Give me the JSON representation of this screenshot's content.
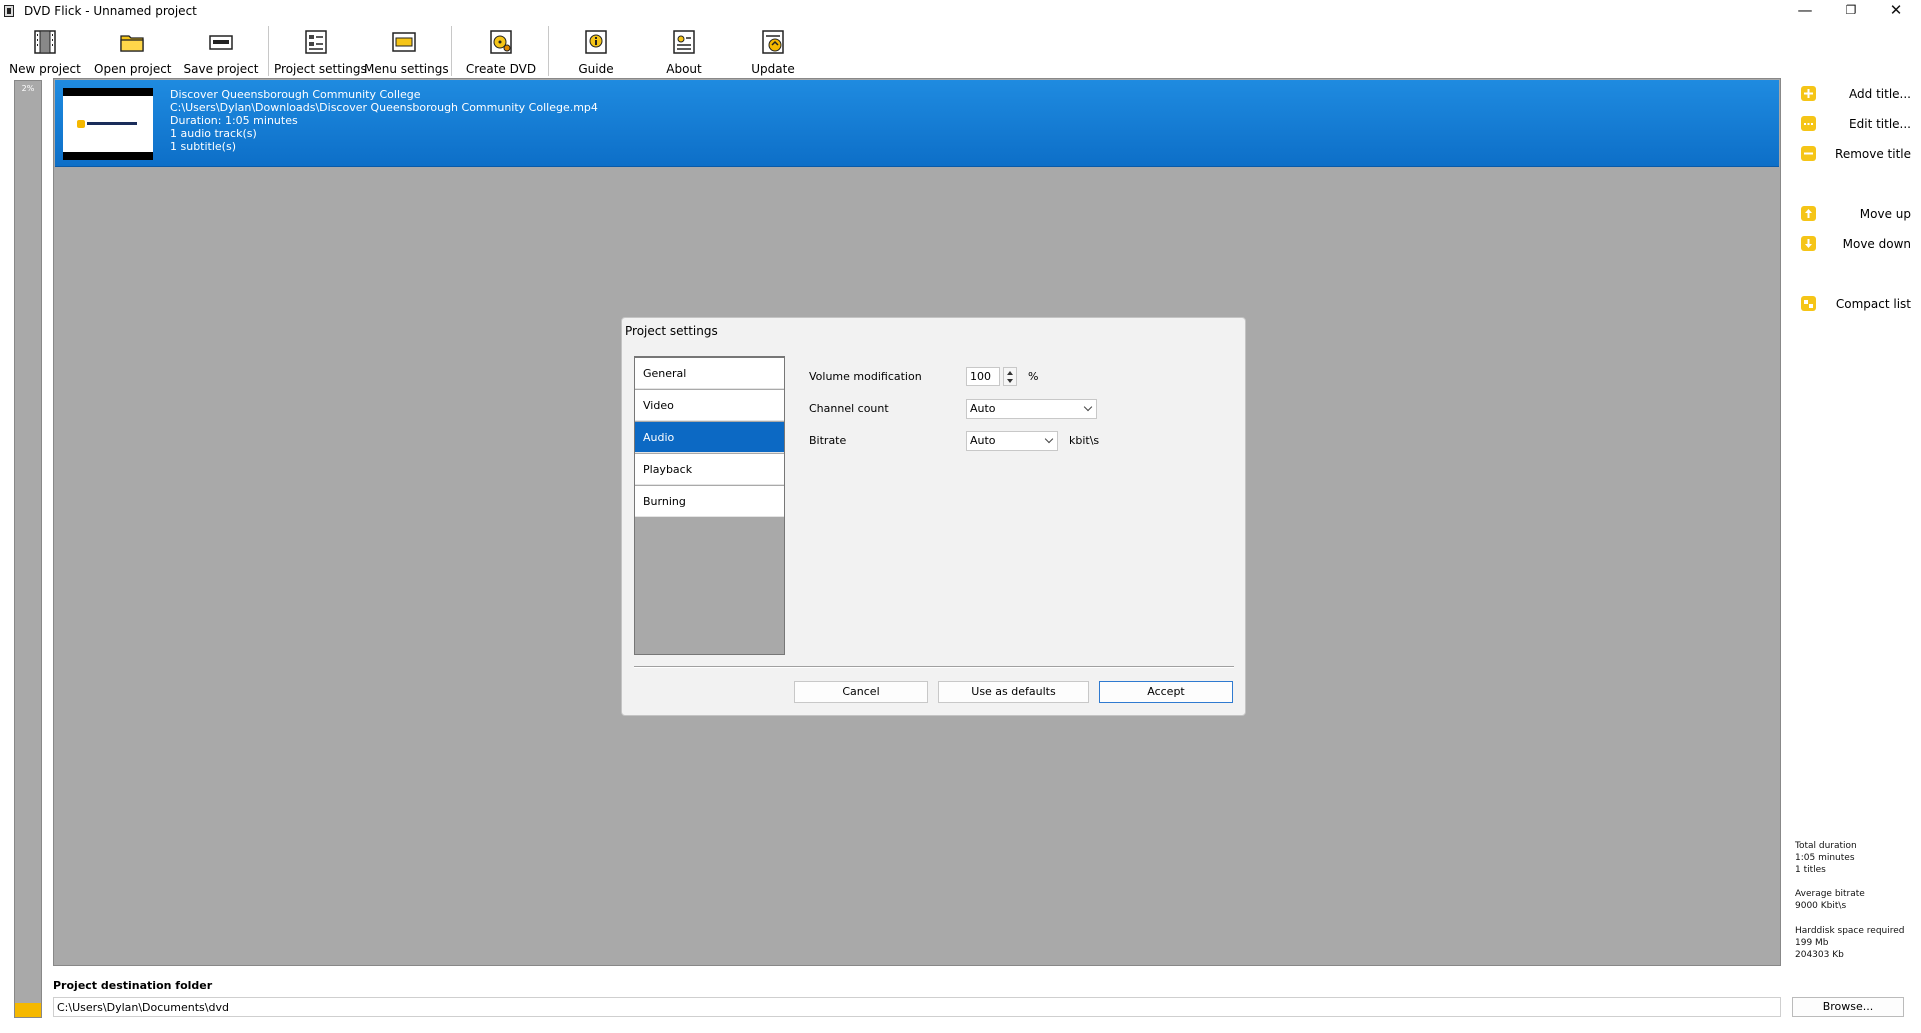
{
  "window": {
    "title": "DVD Flick - Unnamed project",
    "minimize": "—",
    "maximize": "❐",
    "close": "✕"
  },
  "toolbar": {
    "new_project": "New project",
    "open_project": "Open project",
    "save_project": "Save project",
    "project_settings": "Project settings",
    "menu_settings": "Menu settings",
    "create_dvd": "Create DVD",
    "guide": "Guide",
    "about": "About",
    "update": "Update"
  },
  "progress": {
    "label": "2%",
    "value_percent": 2
  },
  "titles": [
    {
      "name": "Discover Queensborough Community College",
      "path": "C:\\Users\\Dylan\\Downloads\\Discover Queensborough Community College.mp4",
      "duration": "Duration: 1:05 minutes",
      "audio": "1 audio track(s)",
      "subtitles": "1 subtitle(s)"
    }
  ],
  "sidebar": {
    "add_title": "Add title...",
    "edit_title": "Edit title...",
    "remove_title": "Remove title",
    "move_up": "Move up",
    "move_down": "Move down",
    "compact_list": "Compact list"
  },
  "stats": {
    "total_duration_label": "Total duration",
    "total_duration_value": "1:05 minutes",
    "titles_count": "1 titles",
    "avg_bitrate_label": "Average bitrate",
    "avg_bitrate_value": "9000 Kbit\\s",
    "hdd_label": "Harddisk space required",
    "hdd_mb": "199 Mb",
    "hdd_kb": "204303 Kb"
  },
  "destination": {
    "label": "Project destination folder",
    "value": "C:\\Users\\Dylan\\Documents\\dvd",
    "browse": "Browse..."
  },
  "dialog": {
    "title": "Project settings",
    "nav": [
      "General",
      "Video",
      "Audio",
      "Playback",
      "Burning"
    ],
    "active_nav": "Audio",
    "volume_label": "Volume modification",
    "volume_value": "100",
    "volume_unit": "%",
    "channel_label": "Channel count",
    "channel_value": "Auto",
    "bitrate_label": "Bitrate",
    "bitrate_value": "Auto",
    "bitrate_unit": "kbit\\s",
    "cancel": "Cancel",
    "use_defaults": "Use as defaults",
    "accept": "Accept"
  },
  "colors": {
    "accent_blue": "#0c69c4",
    "icon_yellow": "#f5c518",
    "list_bg": "#a9a9a9"
  }
}
